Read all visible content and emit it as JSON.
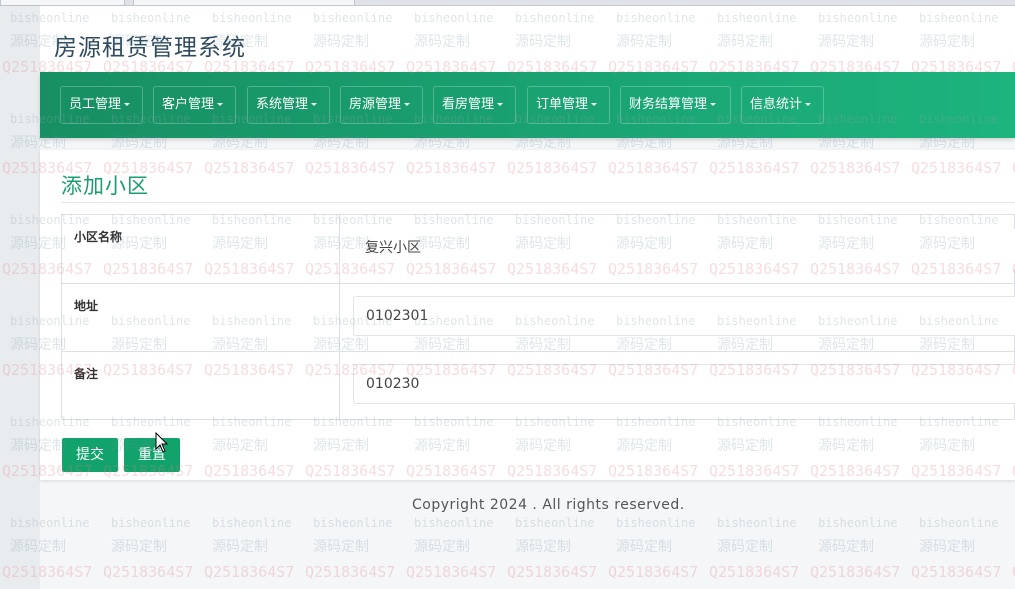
{
  "site": {
    "title": "房源租赁管理系统"
  },
  "nav": {
    "items": [
      {
        "label": "员工管理"
      },
      {
        "label": "客户管理"
      },
      {
        "label": "系统管理"
      },
      {
        "label": "房源管理"
      },
      {
        "label": "看房管理"
      },
      {
        "label": "订单管理"
      },
      {
        "label": "财务结算管理"
      },
      {
        "label": "信息统计"
      }
    ]
  },
  "form": {
    "title": "添加小区",
    "fields": [
      {
        "label": "小区名称",
        "value": "复兴小区"
      },
      {
        "label": "地址",
        "value": "0102301"
      },
      {
        "label": "备注",
        "value": "010230"
      }
    ],
    "submit_label": "提交",
    "reset_label": "重置"
  },
  "footer": {
    "text": "Copyright 2024 . All rights reserved."
  },
  "watermark": {
    "line1": "bisheonline",
    "line2": "源码定制",
    "line3": "Q2518364S7"
  },
  "colors": {
    "accent": "#1a9e6c",
    "nav_start": "#178f62",
    "nav_end": "#1db47e",
    "button": "#12a36d"
  }
}
